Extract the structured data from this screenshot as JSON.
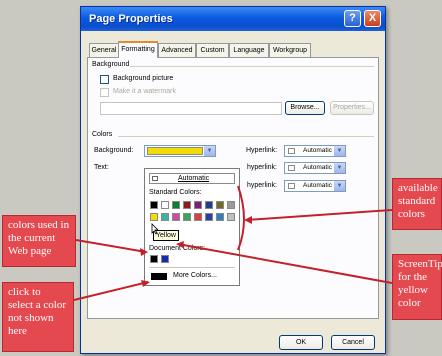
{
  "dialog": {
    "title": "Page Properties",
    "help_glyph": "?",
    "close_glyph": "X",
    "tabs": [
      "General",
      "Formatting",
      "Advanced",
      "Custom",
      "Language",
      "Workgroup"
    ],
    "active_tab": "Formatting",
    "background_group": "Background",
    "background_picture_label": "Background picture",
    "watermark_label": "Make it a watermark",
    "browse_label": "Browse...",
    "properties_label": "Properties...",
    "colors_group": "Colors",
    "background_label": "Background:",
    "text_label": "Text:",
    "hyperlink_label": "Hyperlink:",
    "visited_label": "hyperlink:",
    "active_label": "hyperlink:",
    "automatic": "Automatic",
    "ok_label": "OK",
    "cancel_label": "Cancel"
  },
  "palette": {
    "automatic_label": "Automatic",
    "standard_colors_label": "Standard Colors:",
    "document_colors_label": "Document Colors:",
    "tooltip": "Yellow",
    "more_colors_label": "More Colors..."
  },
  "colors": {
    "selected_background": "#f2dc06",
    "standard_row1": [
      "#000000",
      "#ffffff",
      "#0a7d2e",
      "#8b1a1a",
      "#7a1f7a",
      "#1c3e8c",
      "#6d6d2a",
      "#9a9a9a"
    ],
    "standard_row2": [
      "#f2dc06",
      "#3fb0a5",
      "#c84da5",
      "#3ba55c",
      "#d94040",
      "#2a3fa8",
      "#2f7fb8",
      "#c0c0c0"
    ],
    "document": [
      "#000000",
      "#1b2aa8"
    ],
    "callout": "#e54950"
  },
  "callouts": {
    "colors_used": "colors used in the current Web page",
    "click_to_select": "click to select a color not shown here",
    "available": "available standard colors",
    "screentip": "ScreenTip for the yellow color"
  }
}
